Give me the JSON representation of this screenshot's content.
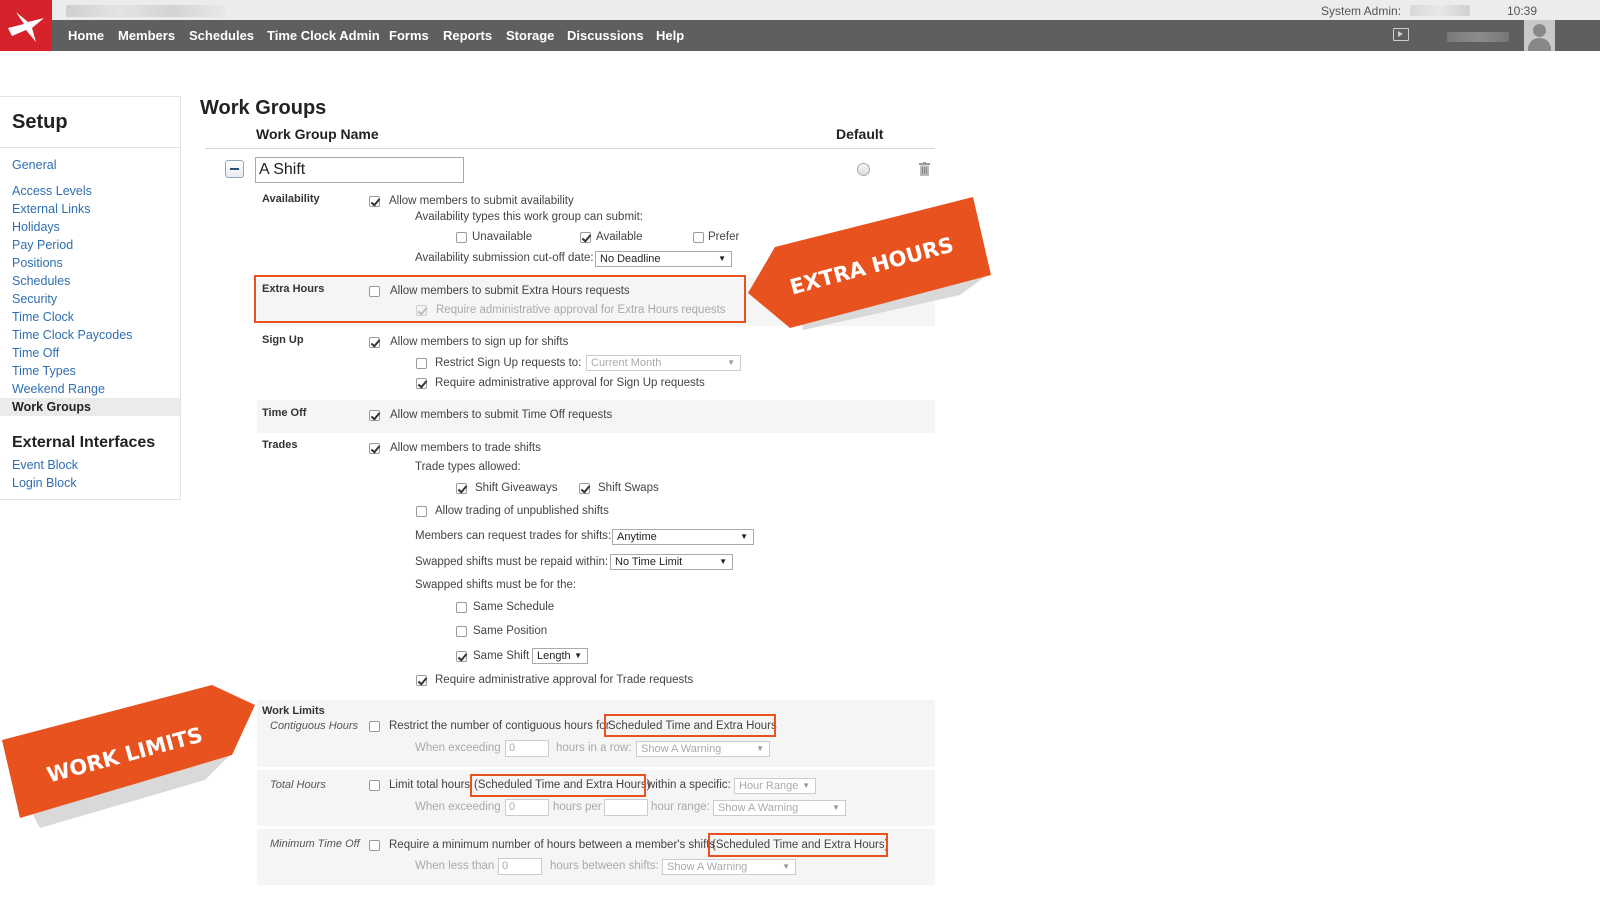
{
  "header": {
    "system_admin_label": "System Admin:",
    "clock": "10:39"
  },
  "nav": {
    "items": [
      "Home",
      "Members",
      "Schedules",
      "Time Clock Admin",
      "Forms",
      "Reports",
      "Storage",
      "Discussions",
      "Help"
    ]
  },
  "sidebar": {
    "title": "Setup",
    "items": [
      "General",
      "Access Levels",
      "External Links",
      "Holidays",
      "Pay Period",
      "Positions",
      "Schedules",
      "Security",
      "Time Clock",
      "Time Clock Paycodes",
      "Time Off",
      "Time Types",
      "Weekend Range",
      "Work Groups"
    ],
    "active_item": "Work Groups",
    "section2_title": "External Interfaces",
    "section2_items": [
      "Event Block",
      "Login Block"
    ]
  },
  "main": {
    "title": "Work Groups",
    "col_name": "Work Group Name",
    "col_default": "Default",
    "group_name": "A Shift",
    "availability": {
      "label": "Availability",
      "allow": "Allow members to submit availability",
      "types_label": "Availability types this work group can submit:",
      "types": [
        "Unavailable",
        "Available",
        "Prefer"
      ],
      "cutoff_label": "Availability submission cut-off date:",
      "cutoff_value": "No Deadline"
    },
    "extra_hours": {
      "label": "Extra Hours",
      "allow": "Allow members to submit Extra Hours requests",
      "approval": "Require administrative approval for Extra Hours requests"
    },
    "sign_up": {
      "label": "Sign Up",
      "allow": "Allow members to sign up for shifts",
      "restrict": "Restrict Sign Up requests to:",
      "restrict_value": "Current Month",
      "approval": "Require administrative approval for Sign Up requests"
    },
    "time_off": {
      "label": "Time Off",
      "allow": "Allow members to submit Time Off requests"
    },
    "trades": {
      "label": "Trades",
      "allow": "Allow members to trade shifts",
      "types_label": "Trade types allowed:",
      "giveaways": "Shift Giveaways",
      "swaps": "Shift Swaps",
      "unpublished": "Allow trading of unpublished shifts",
      "when_label": "Members can request trades for shifts:",
      "when_value": "Anytime",
      "repaid_label": "Swapped shifts must be repaid within:",
      "repaid_value": "No Time Limit",
      "for_label": "Swapped shifts must be for the:",
      "same_schedule": "Same Schedule",
      "same_position": "Same Position",
      "same_shift": "Same Shift",
      "same_shift_value": "Length",
      "approval": "Require administrative approval for Trade requests"
    },
    "work_limits": {
      "label": "Work Limits",
      "contiguous_label": "Contiguous Hours",
      "contiguous_text": "Restrict the number of contiguous hours for",
      "contiguous_scope": "Scheduled Time and Extra Hours",
      "contiguous_exceed": "When exceeding",
      "contiguous_value": "0",
      "contiguous_unit": "hours in a row:",
      "contiguous_action": "Show A Warning",
      "total_label": "Total Hours",
      "total_text": "Limit total hours",
      "total_scope": "(Scheduled Time and Extra Hours)",
      "total_within": "within a specific:",
      "total_range": "Hour Range",
      "total_exceed": "When exceeding",
      "total_value": "0",
      "total_per": "hours per",
      "total_range_label": "hour range:",
      "total_action": "Show A Warning",
      "min_label": "Minimum Time Off",
      "min_text": "Require a minimum number of hours between a member's shifts",
      "min_scope": "(Scheduled Time and Extra Hours)",
      "min_less": "When less than",
      "min_value": "0",
      "min_between": "hours between shifts:",
      "min_action": "Show A Warning"
    }
  },
  "banners": {
    "extra_hours": "EXTRA HOURS",
    "work_limits": "WORK LIMITS"
  },
  "colors": {
    "accent": "#e8521f",
    "logo_red": "#d6232b",
    "nav_bg": "#5f5f5f",
    "link": "#2f6fb0"
  }
}
